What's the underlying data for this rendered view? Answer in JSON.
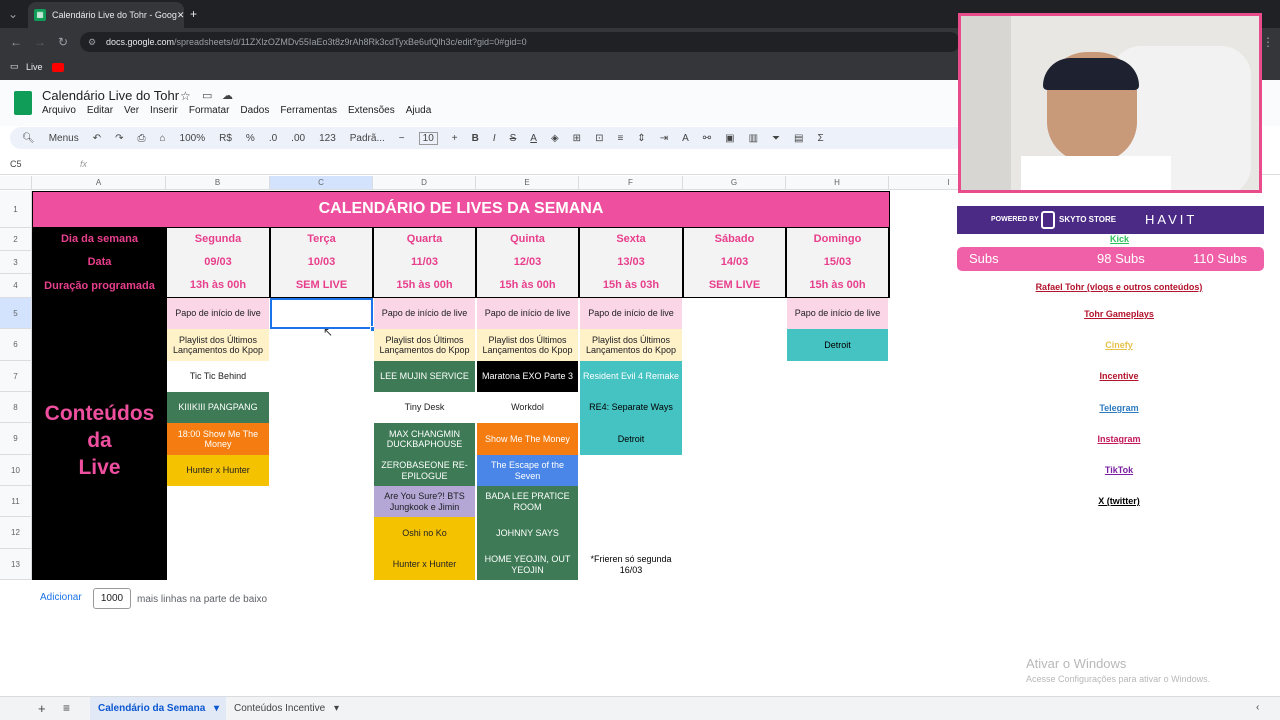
{
  "browser": {
    "tab_title": "Calendário Live do Tohr - Goog",
    "url_host": "docs.google.com",
    "url_path": "/spreadsheets/d/11ZXlzOZMDv55IaEo3t8z9rAh8Rk3cdTyxBe6ufQlh3c/edit?gid=0#gid=0",
    "bookmark_live": "Live"
  },
  "doc": {
    "title": "Calendário Live do Tohr",
    "menus": [
      "Arquivo",
      "Editar",
      "Ver",
      "Inserir",
      "Formatar",
      "Dados",
      "Ferramentas",
      "Extensões",
      "Ajuda"
    ]
  },
  "toolbar": {
    "menus": "Menus",
    "zoom": "100%",
    "currency": "R$",
    "percent": "%",
    "dec_less": ".0",
    "dec_more": ".00",
    "num": "123",
    "font": "Padrã...",
    "size": "10"
  },
  "formula": {
    "cellref": "C5",
    "fx": "fx"
  },
  "columns": [
    "A",
    "B",
    "C",
    "D",
    "E",
    "F",
    "G",
    "H",
    "I"
  ],
  "rows": [
    "1",
    "2",
    "3",
    "4",
    "5",
    "6",
    "7",
    "8",
    "9",
    "10",
    "11",
    "12",
    "13"
  ],
  "sheet": {
    "title": "CALENDÁRIO DE LIVES DA SEMANA",
    "lbl_day": "Dia da semana",
    "lbl_date": "Data",
    "lbl_dur": "Duração programada",
    "days": [
      "Segunda",
      "Terça",
      "Quarta",
      "Quinta",
      "Sexta",
      "Sábado",
      "Domingo"
    ],
    "dates": [
      "09/03",
      "10/03",
      "11/03",
      "12/03",
      "13/03",
      "14/03",
      "15/03"
    ],
    "durations": [
      "13h às 00h",
      "SEM LIVE",
      "15h às 00h",
      "15h às 00h",
      "15h às 03h",
      "SEM LIVE",
      "15h às 00h"
    ],
    "contents_label_1": "Conteúdos",
    "contents_label_2": "da",
    "contents_label_3": "Live",
    "b": [
      "Papo de início de live",
      "Playlist dos Últimos Lançamentos do Kpop",
      "Tic Tic Behind",
      "KIIIKIII PANGPANG",
      "18:00 Show Me The Money",
      "Hunter x Hunter"
    ],
    "d": [
      "Papo de início de live",
      "Playlist dos Últimos Lançamentos do Kpop",
      "LEE MUJIN SERVICE",
      "Tiny Desk",
      "MAX CHANGMIN DUCKBAPHOUSE",
      "ZEROBASEONE RE-EPILOGUE",
      "Are You Sure?! BTS Jungkook e Jimin",
      "Oshi no Ko",
      "Hunter x Hunter"
    ],
    "e": [
      "Papo de início de live",
      "Playlist dos Últimos Lançamentos do Kpop",
      "Maratona EXO Parte 3",
      "Workdol",
      "Show Me The Money",
      "The Escape of the Seven",
      "BADA LEE PRATICE ROOM",
      "JOHNNY SAYS",
      "HOME YEOJIN, OUT YEOJIN"
    ],
    "f": [
      "Papo de início de live",
      "Playlist dos Últimos Lançamentos do Kpop",
      "Resident Evil 4 Remake",
      "RE4: Separate Ways",
      "Detroit",
      "*Frieren só segunda 16/03"
    ],
    "h": [
      "Papo de início de live",
      "Detroit"
    ]
  },
  "side": {
    "powered": "POWERED BY",
    "brand": "HAVIT",
    "sponsor": "SKYTO STORE",
    "kick": "Kick",
    "subs_label": "Subs",
    "subs_mid": "98 Subs",
    "subs_right": "110 Subs",
    "links": [
      "Rafael Tohr (vlogs e outros conteúdos)",
      "Tohr Gameplays",
      "Cinefy",
      "Incentive",
      "Telegram",
      "Instagram",
      "TikTok",
      "X (twitter)"
    ]
  },
  "footer": {
    "add": "Adicionar",
    "rows_value": "1000",
    "rows_text": "mais linhas na parte de baixo"
  },
  "watermark": {
    "title": "Ativar o Windows",
    "sub": "Acesse Configurações para ativar o Windows."
  },
  "tabs": [
    "Calendário da Semana",
    "Conteúdos Incentive"
  ]
}
